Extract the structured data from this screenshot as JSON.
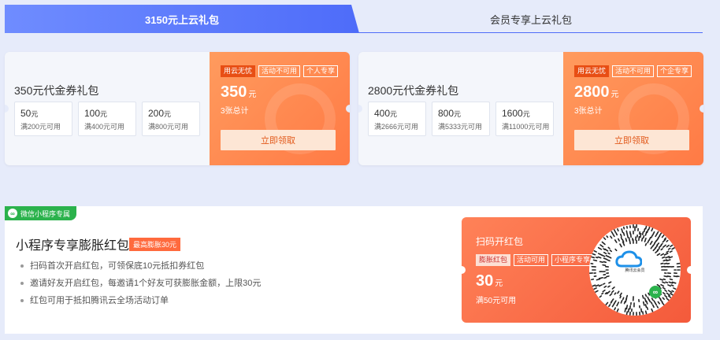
{
  "tabs": [
    {
      "label": "3150元上云礼包",
      "active": true
    },
    {
      "label": "会员专享上云礼包",
      "active": false
    }
  ],
  "colors": {
    "accent": "#4e6cf9",
    "orange": "#ff7a45",
    "red": "#f45a3b",
    "green": "#2bb24c"
  },
  "cards": [
    {
      "title": "350元代金券礼包",
      "vouchers": [
        {
          "amount": "50",
          "unit": "元",
          "cond": "满200元可用"
        },
        {
          "amount": "100",
          "unit": "元",
          "cond": "满400元可用"
        },
        {
          "amount": "200",
          "unit": "元",
          "cond": "满800元可用"
        }
      ],
      "tags": [
        "用云无忧",
        "活动不可用",
        "个人专享"
      ],
      "price": "350",
      "price_unit": "元",
      "count": "3张总计",
      "button": "立即领取"
    },
    {
      "title": "2800元代金券礼包",
      "vouchers": [
        {
          "amount": "400",
          "unit": "元",
          "cond": "满2666元可用"
        },
        {
          "amount": "800",
          "unit": "元",
          "cond": "满5333元可用"
        },
        {
          "amount": "1600",
          "unit": "元",
          "cond": "满11000元可用"
        }
      ],
      "tags": [
        "用云无忧",
        "活动不可用",
        "个企专享"
      ],
      "price": "2800",
      "price_unit": "元",
      "count": "3张总计",
      "button": "立即领取"
    }
  ],
  "mini": {
    "badge": "微信小程序专属",
    "badge_icon": "link-icon",
    "title": "小程序专享膨胀红包",
    "max_tag": "最高膨胀30元",
    "bullets": [
      "扫码首次开启红包，可领保底10元抵扣券红包",
      "邀请好友开启红包，每邀请1个好友可获膨胀金额，上限30元",
      "红包可用于抵扣腾讯云全场活动订单"
    ],
    "red": {
      "title": "扫码开红包",
      "tags": [
        "膨胀红包",
        "活动可用",
        "小程序专享"
      ],
      "price": "30",
      "price_unit": "元",
      "cond": "满50元可用",
      "qr_label": "腾讯云会员",
      "qr_icon": "qr-code-icon"
    }
  }
}
